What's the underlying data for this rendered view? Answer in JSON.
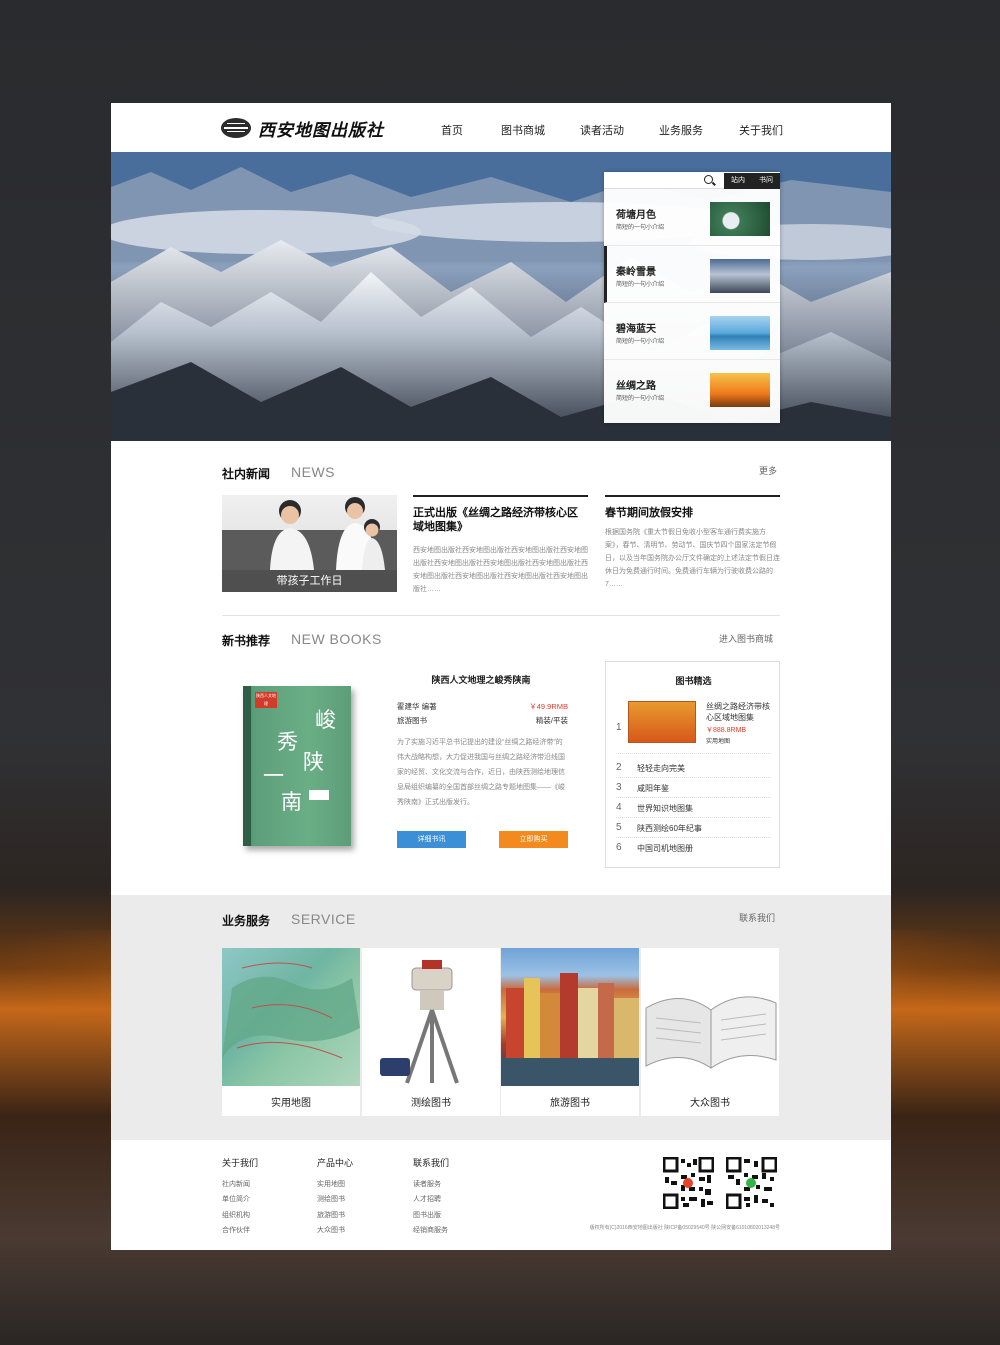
{
  "header": {
    "logo_text": "西安地图出版社",
    "nav": [
      "首页",
      "图书商城",
      "读者活动",
      "业务服务",
      "关于我们"
    ]
  },
  "hero": {
    "search": {
      "tab1": "站内",
      "tab2": "书问"
    },
    "items": [
      {
        "title": "荷塘月色",
        "desc": "简短的一句小介绍"
      },
      {
        "title": "秦岭雪景",
        "desc": "简短的一句小介绍"
      },
      {
        "title": "碧海蓝天",
        "desc": "简短的一句小介绍"
      },
      {
        "title": "丝绸之路",
        "desc": "简短的一句小介绍"
      }
    ]
  },
  "news": {
    "heading": "社内新闻",
    "heading_en": "NEWS",
    "more": "更多",
    "photo_caption": "带孩子工作日",
    "articles": [
      {
        "title": "正式出版《丝绸之路经济带核心区域地图集》",
        "text": "西安地图出版社西安地图出版社西安地图出版社西安地图出版社西安地图出版社西安地图出版社西安地图出版社西安地图出版社西安地图出版社西安地图出版社西安地图出版社……"
      },
      {
        "title": "春节期间放假安排",
        "text": "根据国务院《重大节假日免收小型客车通行费实施方案》，春节、清明节、劳动节、国庆节四个国家法定节假日，以及当年国务院办公厅文件确定的上述法定节假日连休日为免费通行时间。免费通行车辆为行驶收费公路的7……"
      }
    ]
  },
  "books": {
    "heading": "新书推荐",
    "heading_en": "NEW BOOKS",
    "more": "进入图书商城",
    "cover": {
      "chars": [
        "峻",
        "秀",
        "陕",
        "一",
        "南"
      ],
      "badge": "陕西人文地理"
    },
    "feature": {
      "name": "陕西人文地理之峻秀陕南",
      "author": "霍建华 编著",
      "price": "￥49.9RMB",
      "category": "旅游图书",
      "binding": "精装/平装",
      "desc": "为了实施习近平总书记提出的建设“丝绸之路经济带”的伟大战略构想，大力促进我国与丝绸之路经济带沿线国家的经贸、文化交流与合作，近日，由陕西测绘地理信息局组织编纂的全国首部丝绸之路专题地图集——《峻秀陕南》正式出版发行。",
      "detail_btn": "详细书讯",
      "buy_btn": "立即购买"
    },
    "picks": {
      "heading": "图书精选",
      "top": {
        "num": "1",
        "title": "丝绸之路经济带核心区域地图集",
        "price": "￥888.8RMB",
        "category": "实用地图"
      },
      "list": [
        {
          "num": "2",
          "title": "轻轻走向完美"
        },
        {
          "num": "3",
          "title": "咸阳年鉴"
        },
        {
          "num": "4",
          "title": "世界知识地图集"
        },
        {
          "num": "5",
          "title": "陕西测绘60年纪事"
        },
        {
          "num": "6",
          "title": "中国司机地图册"
        }
      ]
    }
  },
  "services": {
    "heading": "业务服务",
    "heading_en": "SERVICE",
    "more": "联系我们",
    "items": [
      "实用地图",
      "测绘图书",
      "旅游图书",
      "大众图书"
    ]
  },
  "footer": {
    "cols": [
      {
        "title": "关于我们",
        "links": [
          "社内新闻",
          "单位简介",
          "组织机构",
          "合作伙伴"
        ]
      },
      {
        "title": "产品中心",
        "links": [
          "实用地图",
          "测绘图书",
          "旅游图书",
          "大众图书"
        ]
      },
      {
        "title": "联系我们",
        "links": [
          "读者服务",
          "人才招聘",
          "图书出版",
          "经销商服务"
        ]
      }
    ],
    "copyright": "版权所有(C)2016西安地图出版社 陕ICP备05029540号 陕公网安备61010802013248号"
  },
  "colors": {
    "accent_blue": "#3b8fd6",
    "accent_orange": "#f28a1e",
    "price_red": "#e83b2a"
  }
}
